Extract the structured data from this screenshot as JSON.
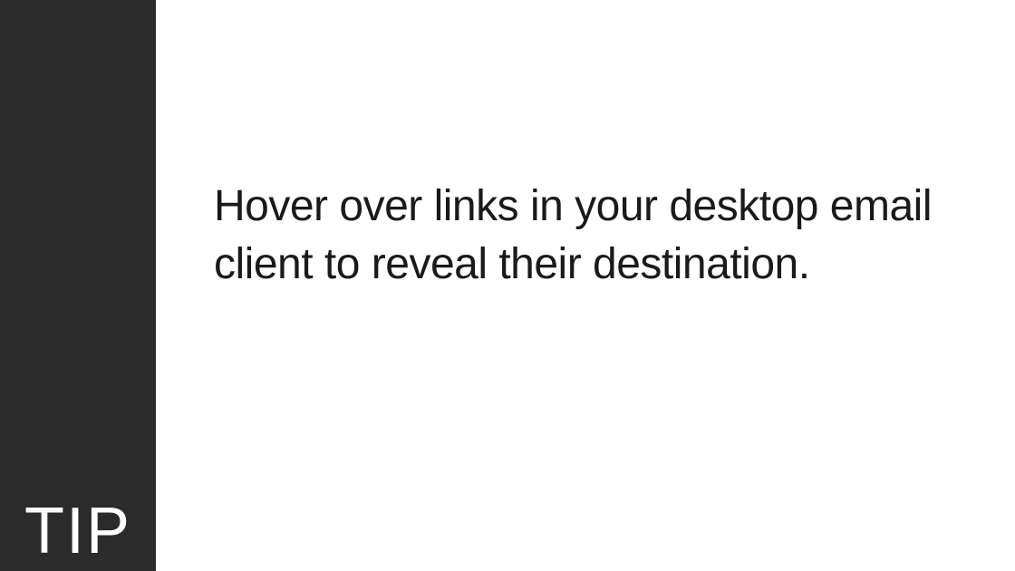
{
  "sidebar": {
    "label": "TIP"
  },
  "content": {
    "tip_text": "Hover over links in your desktop email client to reveal their destination."
  }
}
